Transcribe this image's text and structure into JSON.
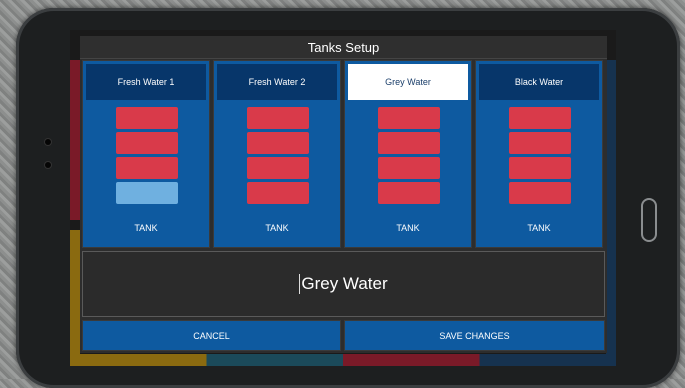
{
  "dialog": {
    "title": "Tanks Setup",
    "name_value": "Grey Water",
    "cancel_label": "CANCEL",
    "save_label": "SAVE CHANGES"
  },
  "tanks": [
    {
      "name": "Fresh Water 1",
      "label": "TANK",
      "selected": false,
      "filled_segments": 3,
      "segments": 4
    },
    {
      "name": "Fresh Water 2",
      "label": "TANK",
      "selected": false,
      "filled_segments": 4,
      "segments": 4
    },
    {
      "name": "Grey Water",
      "label": "TANK",
      "selected": true,
      "filled_segments": 4,
      "segments": 4
    },
    {
      "name": "Black Water",
      "label": "TANK",
      "selected": false,
      "filled_segments": 4,
      "segments": 4
    }
  ],
  "colors": {
    "panel_blue": "#0e5aa0",
    "header_blue": "#07366a",
    "level_full": "#d93a4a",
    "level_empty": "#6fb0e0"
  }
}
